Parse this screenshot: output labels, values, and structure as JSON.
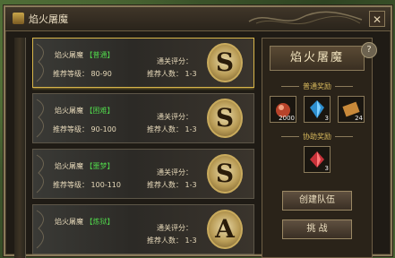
{
  "window": {
    "title": "焰火屠魔",
    "close_label": "✕"
  },
  "dungeons": [
    {
      "name": "焰火屠魔",
      "tag": "【普通】",
      "level_label": "推荐等级：",
      "level": "80-90",
      "eval_label": "通关评分：",
      "people_label": "推荐人数：",
      "people": "1-3",
      "grade": "S",
      "selected": true
    },
    {
      "name": "焰火屠魔",
      "tag": "【困难】",
      "level_label": "推荐等级：",
      "level": "90-100",
      "eval_label": "通关评分：",
      "people_label": "推荐人数：",
      "people": "1-3",
      "grade": "S",
      "selected": false
    },
    {
      "name": "焰火屠魔",
      "tag": "【噩梦】",
      "level_label": "推荐等级：",
      "level": "100-110",
      "eval_label": "通关评分：",
      "people_label": "推荐人数：",
      "people": "1-3",
      "grade": "S",
      "selected": false
    },
    {
      "name": "焰火屠魔",
      "tag": "【炼狱】",
      "level_label": "推荐等级：",
      "level": "",
      "eval_label": "通关评分：",
      "people_label": "推荐人数：",
      "people": "1-3",
      "grade": "A",
      "selected": false
    }
  ],
  "panel": {
    "title": "焰火屠魔",
    "help_label": "?",
    "normal_reward_label": "普通奖励",
    "assist_reward_label": "协助奖励",
    "normal_rewards": [
      {
        "icon": "red-potion-icon",
        "count": "2000"
      },
      {
        "icon": "blue-gem-icon",
        "count": "3"
      },
      {
        "icon": "scroll-icon",
        "count": "24"
      }
    ],
    "assist_rewards": [
      {
        "icon": "red-crystal-icon",
        "count": "3"
      }
    ],
    "create_team_label": "创建队伍",
    "challenge_label": "挑 战"
  }
}
